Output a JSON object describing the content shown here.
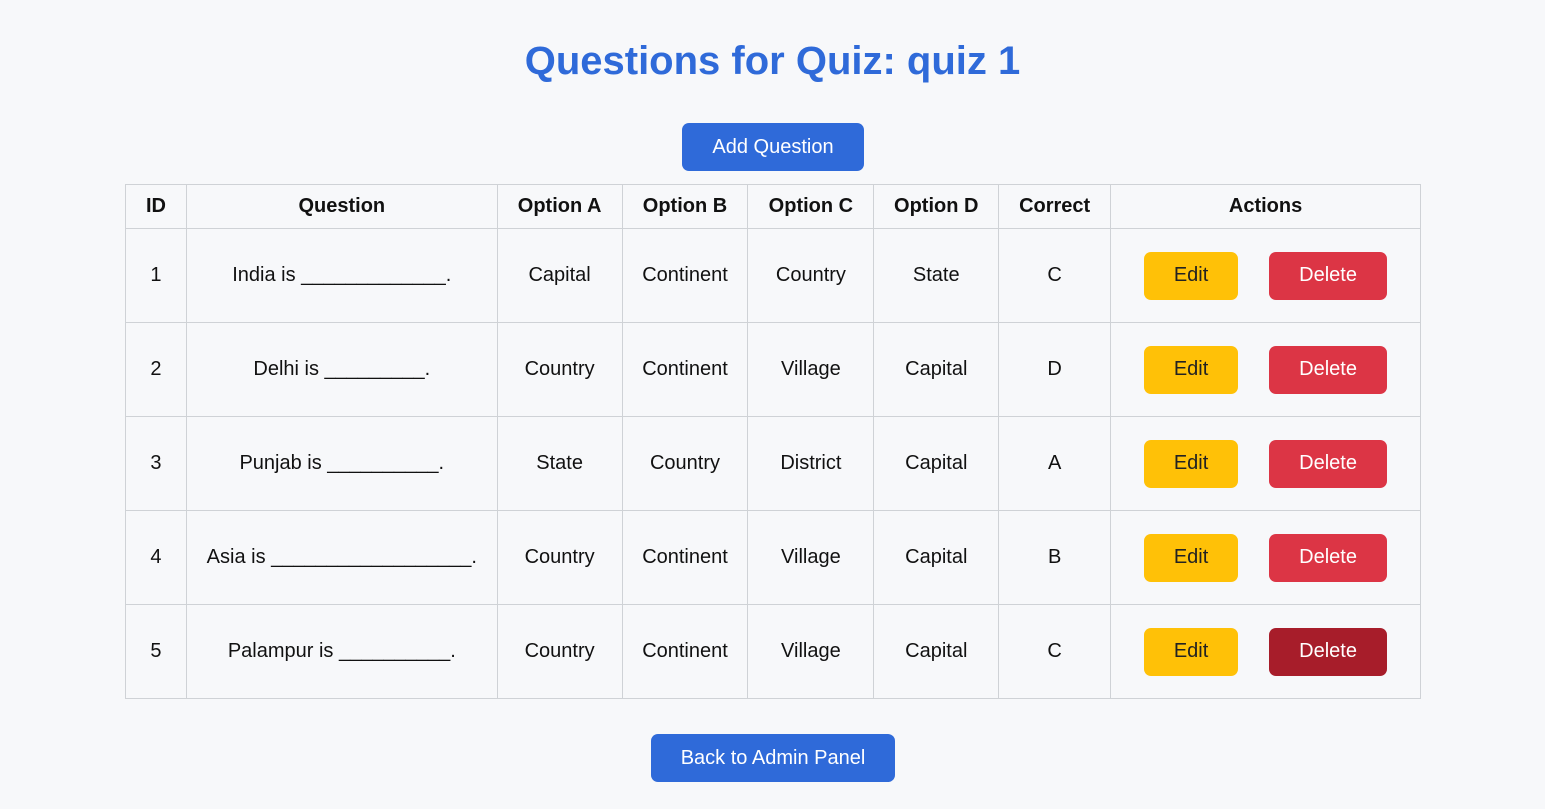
{
  "page": {
    "title": "Questions for Quiz: quiz 1",
    "add_button": "Add Question",
    "back_button": "Back to Admin Panel"
  },
  "table": {
    "headers": [
      "ID",
      "Question",
      "Option A",
      "Option B",
      "Option C",
      "Option D",
      "Correct",
      "Actions"
    ],
    "rows": [
      {
        "id": "1",
        "question": "India is _____________.",
        "a": "Capital",
        "b": "Continent",
        "c": "Country",
        "d": "State",
        "correct": "C",
        "edit": "Edit",
        "delete": "Delete"
      },
      {
        "id": "2",
        "question": "Delhi is _________.",
        "a": "Country",
        "b": "Continent",
        "c": "Village",
        "d": "Capital",
        "correct": "D",
        "edit": "Edit",
        "delete": "Delete"
      },
      {
        "id": "3",
        "question": "Punjab is __________.",
        "a": "State",
        "b": "Country",
        "c": "District",
        "d": "Capital",
        "correct": "A",
        "edit": "Edit",
        "delete": "Delete"
      },
      {
        "id": "4",
        "question": "Asia is __________________.",
        "a": "Country",
        "b": "Continent",
        "c": "Village",
        "d": "Capital",
        "correct": "B",
        "edit": "Edit",
        "delete": "Delete"
      },
      {
        "id": "5",
        "question": "Palampur is __________.",
        "a": "Country",
        "b": "Continent",
        "c": "Village",
        "d": "Capital",
        "correct": "C",
        "edit": "Edit",
        "delete": "Delete"
      }
    ]
  },
  "colors": {
    "primary": "#2f6ad9",
    "edit": "#ffc107",
    "delete": "#dc3545",
    "delete_hover": "#a71d2a",
    "background": "#f7f8fa"
  }
}
